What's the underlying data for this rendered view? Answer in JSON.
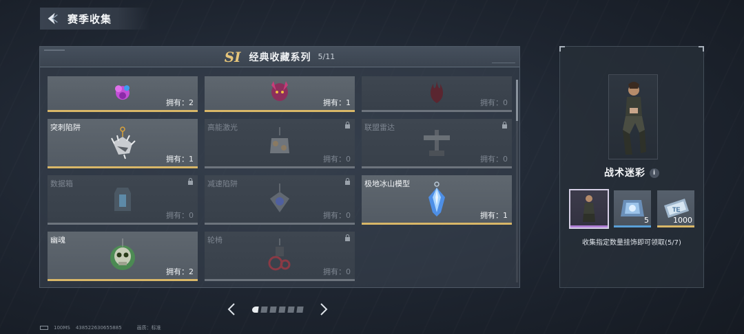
{
  "header": {
    "title": "赛季收集"
  },
  "series": {
    "badge": "SI",
    "title": "经典收藏系列",
    "count": "5/11"
  },
  "cards": [
    {
      "name": "",
      "count": "拥有：2",
      "locked": false,
      "icon": "purple-ornament-icon"
    },
    {
      "name": "",
      "count": "拥有：1",
      "locked": false,
      "icon": "jester-charm-icon"
    },
    {
      "name": "",
      "count": "拥有：0",
      "locked": true,
      "icon": "dark-flame-icon"
    },
    {
      "name": "突刺陷阱",
      "count": "拥有：1",
      "locked": false,
      "icon": "spike-trap-icon"
    },
    {
      "name": "高能激光",
      "count": "拥有：0",
      "locked": true,
      "icon": "laser-icon"
    },
    {
      "name": "联盟雷达",
      "count": "拥有：0",
      "locked": true,
      "icon": "radar-icon"
    },
    {
      "name": "数据箱",
      "count": "拥有：0",
      "locked": true,
      "icon": "data-box-icon"
    },
    {
      "name": "减速陷阱",
      "count": "拥有：0",
      "locked": true,
      "icon": "slow-trap-icon"
    },
    {
      "name": "极地冰山模型",
      "count": "拥有：1",
      "locked": false,
      "icon": "iceberg-crystal-icon"
    },
    {
      "name": "幽魂",
      "count": "拥有：2",
      "locked": false,
      "icon": "ghost-skull-icon"
    },
    {
      "name": "轮椅",
      "count": "拥有：0",
      "locked": true,
      "icon": "wheelchair-icon"
    }
  ],
  "reward": {
    "name": "战术迷彩",
    "info_symbol": "i",
    "items": [
      {
        "qty": "",
        "icon": "character-skin-icon"
      },
      {
        "qty": "5",
        "icon": "supply-crate-icon"
      },
      {
        "qty": "1000",
        "icon": "ticket-icon"
      }
    ],
    "description": "收集指定数量挂饰即可领取(5/7)"
  },
  "pager": {
    "pages": 7,
    "current": 1
  },
  "footer": {
    "ping": "100MS",
    "uid": "438522630655885",
    "quality_label": "画质：标准"
  },
  "colors": {
    "gold": "#d9b768",
    "accent_blue": "#5aa0d8",
    "purple": "#b07fd6"
  }
}
